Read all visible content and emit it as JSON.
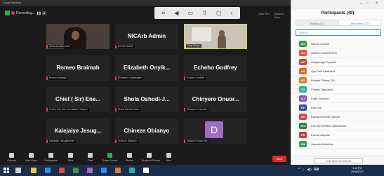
{
  "window": {
    "title": "Zoom Meeting"
  },
  "meeting_bar": {
    "recording": "Recording...",
    "right_labels": [
      "Stop Rec",
      "Speaker View"
    ]
  },
  "share_toolbar": {
    "icons": [
      "capture-icon",
      "mute-icon",
      "video-icon",
      "share-icon",
      "chat-icon",
      "more-icon"
    ]
  },
  "tiles": [
    {
      "name": "",
      "label": "Deborah Akinmade",
      "type": "video-woman"
    },
    {
      "name": "NICArb Admin",
      "label": "NICArb Admin",
      "type": "name"
    },
    {
      "name": "",
      "label": "Ope Okoye",
      "type": "video-man"
    },
    {
      "name": "Romeo Braimah",
      "label": "Romeo Braimah",
      "type": "name"
    },
    {
      "name": "Elizabeth Onyik...",
      "label": "Elizabeth Onyikeogbe",
      "type": "name"
    },
    {
      "name": "Echeho Godfrey",
      "label": "Echeho Godfrey",
      "type": "name"
    },
    {
      "name": "Chief ( Sir) Ene...",
      "label": "Chief ( Sir) Ene Ezenwafor Oragwu",
      "type": "name"
    },
    {
      "name": "Shola Oshodi-J...",
      "label": "Shola Oshodi-John",
      "type": "name"
    },
    {
      "name": "Chinyere Onuor...",
      "label": "Chinyere Onuorah",
      "type": "name"
    },
    {
      "name": "Kalejaiye Jesug...",
      "label": "Kalejaiye Jesugbemide",
      "type": "name"
    },
    {
      "name": "Chineze Obianyo",
      "label": "Chineze Obianyo",
      "type": "name"
    },
    {
      "name": "",
      "label": "Deborah Nosa-Idiri",
      "type": "avatar",
      "initial": "D"
    }
  ],
  "controls": [
    {
      "label": "Unmute",
      "icon": "microphone-icon"
    },
    {
      "label": "Start Video",
      "icon": "camera-icon"
    },
    {
      "label": "Participants",
      "icon": "participants-icon"
    },
    {
      "label": "Polls",
      "icon": "polls-icon"
    },
    {
      "label": "Chat",
      "icon": "chat-icon"
    },
    {
      "label": "Share Screen",
      "icon": "share-screen-icon"
    },
    {
      "label": "Record",
      "icon": "record-icon"
    },
    {
      "label": "Breakout Rooms",
      "icon": "breakout-icon"
    },
    {
      "label": "More",
      "icon": "more-icon"
    }
  ],
  "end_button": "End",
  "panel": {
    "title": "Participants (48)",
    "tabs": [
      "Waiting (2)",
      "Attendees (22)"
    ],
    "search_placeholder": "Search",
    "participants": [
      {
        "initials": "NO",
        "name": "Nkechi Ochiuu",
        "color": "#3a9a4a"
      },
      {
        "initials": "AO",
        "name": "AMIRA OLADIPUPO",
        "color": "#e0544e"
      },
      {
        "initials": "AP",
        "name": "Adegbenga Popoola",
        "color": "#c84a3a"
      },
      {
        "initials": "AA",
        "name": "Ayo Dele Abubakar",
        "color": "#e06a2a"
      },
      {
        "initials": "BO",
        "name": "Bolanle Obima, SA...",
        "color": "#e07a2a"
      },
      {
        "initials": "CO",
        "name": "Charity Ogboanyi",
        "color": "#2bb0a0"
      },
      {
        "initials": "EJ",
        "name": "Edith Johnson",
        "color": "#8a5ac0"
      },
      {
        "initials": "EE",
        "name": "Ene Eze",
        "color": "#3a4a9a"
      },
      {
        "initials": "ES",
        "name": "Eseka Kenneth Samuel",
        "color": "#d04a3a"
      },
      {
        "initials": "EO",
        "name": "EZE BLESSING OBIANUJU",
        "color": "#2a8a4a"
      },
      {
        "initials": "FB",
        "name": "Favour Bayode",
        "color": "#c83a3a"
      },
      {
        "initials": "HA",
        "name": "Hannah Abimbola",
        "color": "#3aa05a"
      }
    ],
    "footer_button": "Invite   Mute All   Admit All"
  },
  "taskbar": {
    "apps": [
      "#f2c744",
      "#2d8cff",
      "#e04848",
      "#3a9a4a",
      "#9b6fc2",
      "#2d8cff",
      "#e07a2a",
      "#2bb0a0",
      "#ffffff"
    ],
    "tray": "^ ⌂ ◀) ⌨",
    "time": "3:15 PM",
    "date": "29/08/2020"
  }
}
